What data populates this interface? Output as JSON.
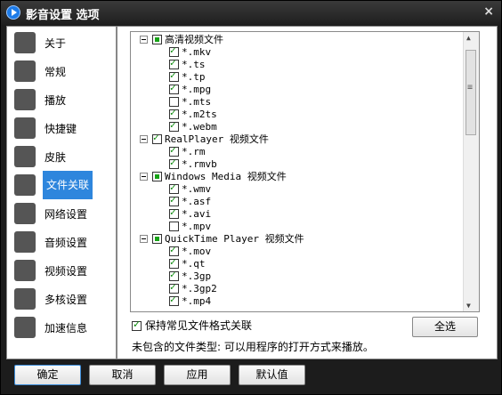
{
  "window": {
    "title": "影音设置 选项",
    "close": "×"
  },
  "sidebar": {
    "items": [
      {
        "label": "关于",
        "icon": "about-icon"
      },
      {
        "label": "常规",
        "icon": "gear-icon"
      },
      {
        "label": "播放",
        "icon": "play-icon"
      },
      {
        "label": "快捷键",
        "icon": "keyboard-icon"
      },
      {
        "label": "皮肤",
        "icon": "shirt-icon"
      },
      {
        "label": "文件关联",
        "icon": "folder-icon",
        "active": true
      },
      {
        "label": "网络设置",
        "icon": "network-icon"
      },
      {
        "label": "音频设置",
        "icon": "audio-icon"
      },
      {
        "label": "视频设置",
        "icon": "tv-icon"
      },
      {
        "label": "多核设置",
        "icon": "cpu-icon"
      },
      {
        "label": "加速信息",
        "icon": "boost-icon"
      }
    ]
  },
  "tree": [
    {
      "type": "group",
      "label": "高清视频文件",
      "state": "partial"
    },
    {
      "type": "item",
      "label": "*.mkv",
      "checked": true
    },
    {
      "type": "item",
      "label": "*.ts",
      "checked": true
    },
    {
      "type": "item",
      "label": "*.tp",
      "checked": true
    },
    {
      "type": "item",
      "label": "*.mpg",
      "checked": true
    },
    {
      "type": "item",
      "label": "*.mts",
      "checked": false
    },
    {
      "type": "item",
      "label": "*.m2ts",
      "checked": true
    },
    {
      "type": "item",
      "label": "*.webm",
      "checked": true
    },
    {
      "type": "group",
      "label": "RealPlayer 视频文件",
      "state": "checked"
    },
    {
      "type": "item",
      "label": "*.rm",
      "checked": true
    },
    {
      "type": "item",
      "label": "*.rmvb",
      "checked": true
    },
    {
      "type": "group",
      "label": "Windows Media 视频文件",
      "state": "partial"
    },
    {
      "type": "item",
      "label": "*.wmv",
      "checked": true
    },
    {
      "type": "item",
      "label": "*.asf",
      "checked": true
    },
    {
      "type": "item",
      "label": "*.avi",
      "checked": true
    },
    {
      "type": "item",
      "label": "*.mpv",
      "checked": false
    },
    {
      "type": "group",
      "label": "QuickTime Player 视频文件",
      "state": "partial"
    },
    {
      "type": "item",
      "label": "*.mov",
      "checked": true
    },
    {
      "type": "item",
      "label": "*.qt",
      "checked": true
    },
    {
      "type": "item",
      "label": "*.3gp",
      "checked": true
    },
    {
      "type": "item",
      "label": "*.3gp2",
      "checked": true
    },
    {
      "type": "item",
      "label": "*.mp4",
      "checked": true
    }
  ],
  "options": {
    "keep_label": "保持常见文件格式关联",
    "keep_checked": true,
    "select_all": "全选",
    "info": "未包含的文件类型: 可以用程序的打开方式来播放。"
  },
  "buttons": {
    "ok": "确定",
    "cancel": "取消",
    "apply": "应用",
    "default": "默认值"
  }
}
